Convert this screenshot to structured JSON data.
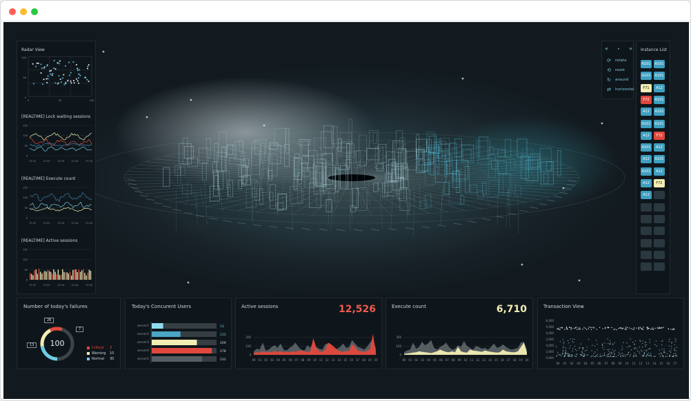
{
  "window": {
    "controls": [
      {
        "name": "close",
        "color": "#fe5f57"
      },
      {
        "name": "minimize",
        "color": "#febc2e"
      },
      {
        "name": "maximize",
        "color": "#28c840"
      }
    ]
  },
  "radar": {
    "title": "Radar View",
    "y_ticks": [
      "100",
      "50",
      "0"
    ],
    "x_ticks": [
      "0",
      "50",
      "100"
    ]
  },
  "lock_waiting": {
    "title": "[REALTIME] Lock waiting sessions",
    "y_ticks": [
      "150",
      "100",
      "50",
      "0"
    ],
    "x_ticks": [
      "17:21",
      "17:22",
      "17:23",
      "17:24",
      "17:25"
    ]
  },
  "execute_realtime": {
    "title": "[REALTIME] Execute count",
    "y_ticks": [
      "150",
      "100",
      "50",
      "0"
    ],
    "x_ticks": [
      "17:21",
      "17:22",
      "17:23",
      "17:24",
      "17:25"
    ]
  },
  "active_realtime": {
    "title": "[REALTIME] Active sessions",
    "y_ticks": [
      "150",
      "100",
      "50",
      "0"
    ],
    "x_ticks": [
      "17:21",
      "17:22",
      "17:23",
      "17:24",
      "17:25"
    ]
  },
  "controls": {
    "items": [
      {
        "icon": "rotate-icon",
        "glyph": "⟳",
        "label": "rotate"
      },
      {
        "icon": "reset-icon",
        "glyph": "⟲",
        "label": "reset"
      },
      {
        "icon": "around-icon",
        "glyph": "↻",
        "label": "around"
      },
      {
        "icon": "horizontal-icon",
        "glyph": "⇄",
        "label": "horizontal"
      }
    ],
    "nav": [
      "«",
      "•",
      "»"
    ]
  },
  "instance_list": {
    "title": "Instance List",
    "colors": {
      "blue": "#3f9fc0",
      "yellow": "#f2edb2",
      "red": "#e0483d",
      "empty": "#2a383f"
    },
    "rows": [
      [
        {
          "label": "A101",
          "status": "blue"
        },
        {
          "label": "A101",
          "status": "blue"
        }
      ],
      [
        {
          "label": "A101",
          "status": "blue"
        },
        {
          "label": "A101",
          "status": "blue"
        }
      ],
      [
        {
          "label": "F71",
          "status": "yellow"
        },
        {
          "label": "A12",
          "status": "blue"
        }
      ],
      [
        {
          "label": "F72",
          "status": "red"
        },
        {
          "label": "A101",
          "status": "blue"
        }
      ],
      [
        {
          "label": "A12",
          "status": "blue"
        },
        {
          "label": "A101",
          "status": "blue"
        }
      ],
      [
        {
          "label": "A101",
          "status": "blue"
        },
        {
          "label": "A101",
          "status": "blue"
        }
      ],
      [
        {
          "label": "A12",
          "status": "blue"
        },
        {
          "label": "F72",
          "status": "red"
        }
      ],
      [
        {
          "label": "A101",
          "status": "blue"
        },
        {
          "label": "A12",
          "status": "blue"
        }
      ],
      [
        {
          "label": "A12",
          "status": "blue"
        },
        {
          "label": "A101",
          "status": "blue"
        }
      ],
      [
        {
          "label": "A101",
          "status": "blue"
        },
        {
          "label": "A12",
          "status": "blue"
        }
      ],
      [
        {
          "label": "A12",
          "status": "blue"
        },
        {
          "label": "F72",
          "status": "yellow"
        }
      ],
      [
        {
          "label": "A12",
          "status": "blue"
        },
        {
          "label": "",
          "status": "empty"
        }
      ],
      [
        {
          "label": "",
          "status": "empty"
        },
        {
          "label": "",
          "status": "empty"
        }
      ],
      [
        {
          "label": "",
          "status": "empty"
        },
        {
          "label": "",
          "status": "empty"
        }
      ],
      [
        {
          "label": "",
          "status": "empty"
        },
        {
          "label": "",
          "status": "empty"
        }
      ],
      [
        {
          "label": "",
          "status": "empty"
        },
        {
          "label": "",
          "status": "empty"
        }
      ],
      [
        {
          "label": "",
          "status": "empty"
        },
        {
          "label": "",
          "status": "empty"
        }
      ],
      [
        {
          "label": "",
          "status": "empty"
        },
        {
          "label": "",
          "status": "empty"
        }
      ]
    ]
  },
  "failures": {
    "title": "Number of today's failures",
    "center": "100",
    "badges": [
      "26",
      "7",
      "13"
    ],
    "colors": {
      "critical": "#e0483d",
      "warning": "#f2edb2",
      "normal": "#6fcde6"
    },
    "legend": [
      {
        "label": "Critical",
        "value": "3",
        "color": "#e0483d"
      },
      {
        "label": "Warning",
        "value": "10",
        "color": "#f2edb2"
      },
      {
        "label": "Normal",
        "value": "30",
        "color": "#6fcde6"
      }
    ]
  },
  "concurrent": {
    "title": "Today's Concurent Users",
    "chart_data": {
      "type": "bar",
      "orientation": "horizontal",
      "categories": [
        "server1",
        "server2",
        "server3",
        "server4",
        "server5"
      ],
      "values": [
        53,
        133,
        209,
        278,
        233
      ],
      "labels": [
        "53",
        "133",
        "209",
        "278",
        "233"
      ],
      "colors": [
        "#8fdcef",
        "#4aa6c6",
        "#f2edb2",
        "#e0483d",
        "#555f63"
      ],
      "xlim": [
        0,
        300
      ]
    }
  },
  "active_sessions": {
    "title": "Active sessions",
    "value": "12,526",
    "value_color": "#f05a4c",
    "chart_data": {
      "type": "area",
      "x": [
        "00",
        "01",
        "02",
        "03",
        "04",
        "05",
        "06",
        "07",
        "08",
        "09",
        "10",
        "11",
        "12",
        "13",
        "14",
        "15",
        "16",
        "17",
        "18",
        "19",
        "20"
      ],
      "ylim": [
        0,
        300
      ],
      "y_ticks": [
        "0",
        "100",
        "200"
      ],
      "series": [
        {
          "color": "#6e757a",
          "values": [
            40,
            70,
            60,
            140,
            50,
            60,
            90,
            110,
            80,
            130,
            60,
            50,
            80,
            100,
            140,
            90,
            60,
            50,
            110,
            80,
            150,
            90,
            70,
            60,
            120,
            130,
            80,
            60,
            70,
            90,
            130,
            80,
            90,
            170,
            130,
            90,
            80,
            60,
            90,
            140,
            180,
            70
          ]
        },
        {
          "color": "#e0483d",
          "values": [
            20,
            30,
            25,
            40,
            30,
            35,
            30,
            45,
            35,
            40,
            30,
            35,
            30,
            40,
            35,
            45,
            50,
            40,
            35,
            40,
            190,
            80,
            40,
            35,
            60,
            140,
            120,
            90,
            60,
            40,
            35,
            45,
            40,
            120,
            90,
            50,
            40,
            35,
            45,
            60,
            240,
            40
          ]
        }
      ]
    }
  },
  "execute_count": {
    "title": "Execute count",
    "value": "6,710",
    "value_color": "#f2edb2",
    "chart_data": {
      "type": "area",
      "x": [
        "00",
        "01",
        "02",
        "03",
        "04",
        "05",
        "06",
        "07",
        "08",
        "09",
        "10",
        "11",
        "12",
        "13",
        "14",
        "15",
        "16",
        "17",
        "18",
        "19",
        "20"
      ],
      "ylim": [
        0,
        300
      ],
      "y_ticks": [
        "0",
        "100",
        "200"
      ],
      "series": [
        {
          "color": "#6e757a",
          "values": [
            30,
            50,
            60,
            140,
            70,
            90,
            150,
            110,
            130,
            170,
            80,
            60,
            90,
            110,
            140,
            90,
            60,
            70,
            110,
            90,
            160,
            100,
            80,
            60,
            100,
            90,
            70,
            80,
            60,
            90,
            130,
            80,
            90,
            120,
            90,
            70,
            60,
            70,
            80,
            140,
            150,
            60
          ]
        },
        {
          "color": "#f2edb2",
          "values": [
            10,
            15,
            20,
            25,
            30,
            40,
            35,
            30,
            25,
            20,
            30,
            40,
            60,
            45,
            35,
            30,
            40,
            30,
            90,
            40,
            30,
            25,
            60,
            50,
            45,
            40,
            35,
            50,
            40,
            35,
            30,
            25,
            30,
            60,
            40,
            35,
            30,
            30,
            40,
            90,
            140,
            30
          ]
        }
      ]
    }
  },
  "transaction": {
    "title": "Transaction View",
    "y_ticks": [
      "0,000",
      "2,000",
      "4,000",
      "3,000",
      "4,000",
      "5,000",
      "6,000"
    ],
    "x_ticks": [
      "00",
      "01",
      "02",
      "03",
      "04",
      "05",
      "06",
      "07",
      "08",
      "09",
      "10",
      "11",
      "12",
      "13",
      "14",
      "15",
      "16",
      "17"
    ]
  }
}
